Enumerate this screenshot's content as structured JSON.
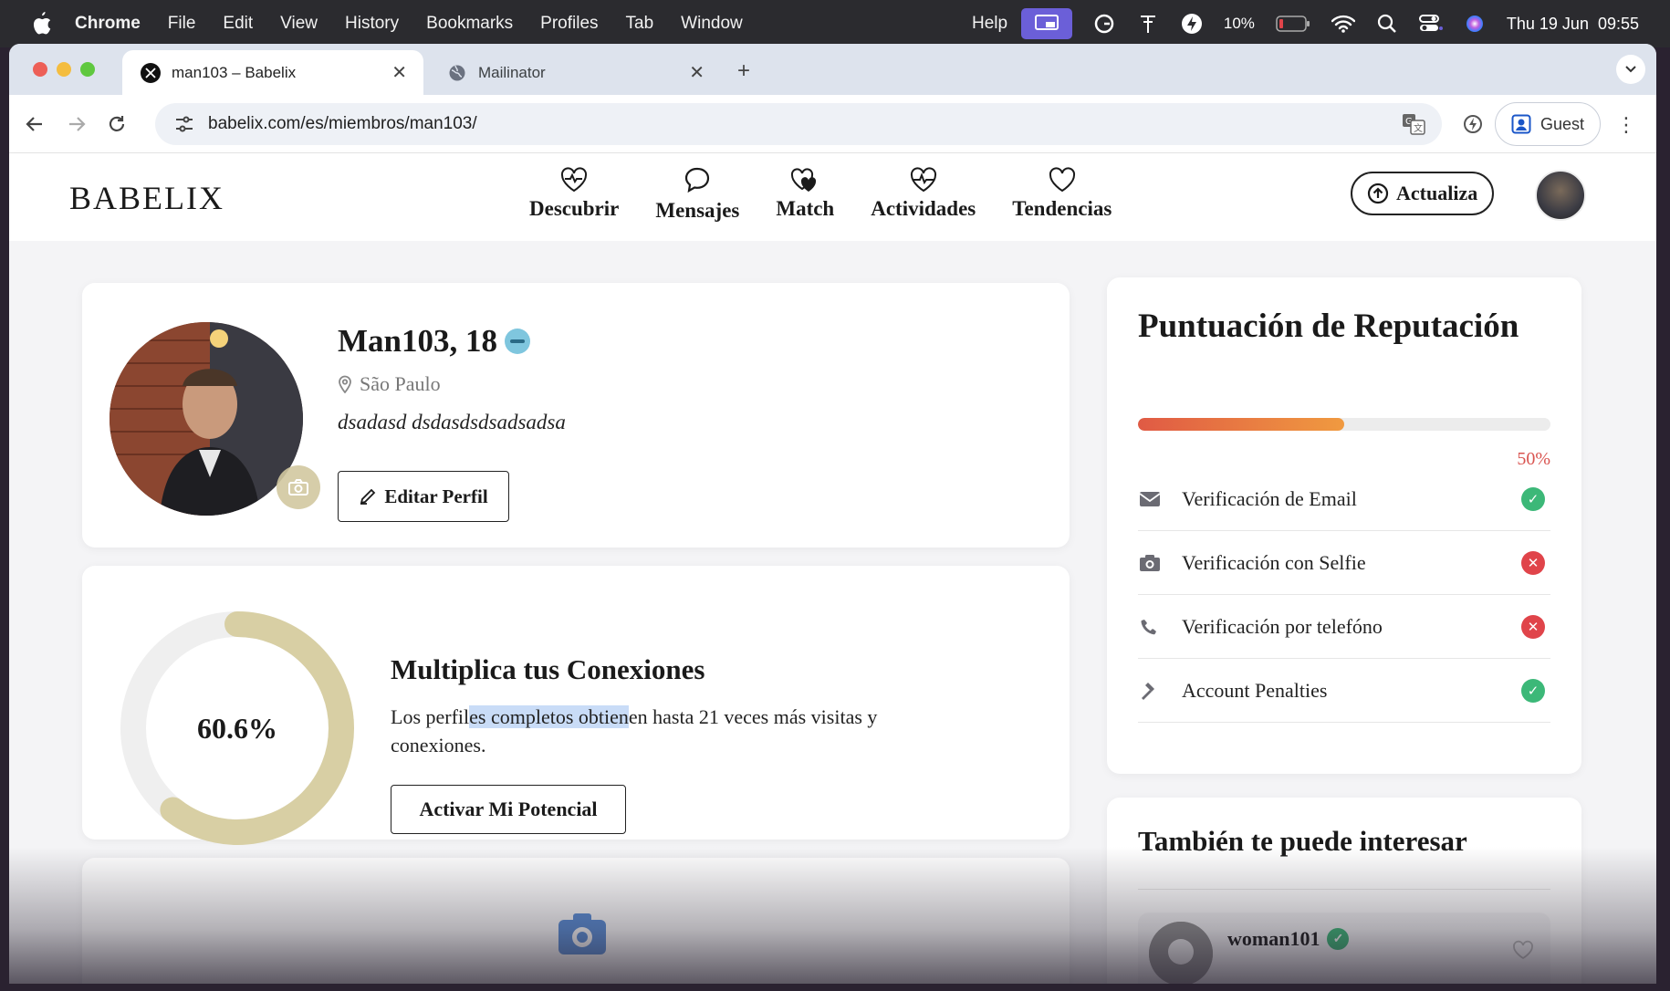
{
  "menubar": {
    "app": "Chrome",
    "items": [
      "File",
      "Edit",
      "View",
      "History",
      "Bookmarks",
      "Profiles",
      "Tab",
      "Window"
    ],
    "help": "Help",
    "battery": "10%",
    "datetime": "Thu 19 Jun  09:55"
  },
  "browser": {
    "tabs": [
      {
        "title": "man103 – Babelix",
        "active": true,
        "icon": "x-logo-icon"
      },
      {
        "title": "Mailinator",
        "active": false,
        "icon": "globe-icon"
      }
    ],
    "url": "babelix.com/es/miembros/man103/",
    "profile_label": "Guest"
  },
  "site": {
    "logo": "BABELIX",
    "nav": [
      {
        "label": "Descubrir",
        "icon": "heartbeat-heart-icon"
      },
      {
        "label": "Mensajes",
        "icon": "chat-bubble-icon"
      },
      {
        "label": "Match",
        "icon": "double-heart-icon"
      },
      {
        "label": "Actividades",
        "icon": "heartbeat-icon"
      },
      {
        "label": "Tendencias",
        "icon": "heart-outline-icon"
      }
    ],
    "upgrade_label": "Actualiza"
  },
  "profile": {
    "name": "Man103, 18",
    "location": "São Paulo",
    "bio": "dsadasd dsdasdsdsadsadsa",
    "edit_label": "Editar Perfil"
  },
  "connections": {
    "percent_label": "60.6%",
    "percent_value": 0.606,
    "title": "Multiplica tus Conexiones",
    "text_pre": "Los perfil",
    "text_highlight": "es completos obtien",
    "text_post": "en hasta 21 veces más visitas y conexiones.",
    "button": "Activar Mi Potencial"
  },
  "reputation": {
    "title": "Puntuación de Reputación",
    "percent_label": "50%",
    "percent_value": 0.5,
    "items": [
      {
        "label": "Verificación de Email",
        "icon": "envelope-icon",
        "status": "ok"
      },
      {
        "label": "Verificación con Selfie",
        "icon": "camera-icon",
        "status": "fail"
      },
      {
        "label": "Verificación por telefóno",
        "icon": "phone-icon",
        "status": "fail"
      },
      {
        "label": "Account Penalties",
        "icon": "gavel-icon",
        "status": "ok"
      }
    ]
  },
  "suggestions": {
    "title": "También te puede interesar",
    "items": [
      {
        "name": "woman101",
        "verified": true
      }
    ]
  },
  "colors": {
    "ok": "#3cb878",
    "fail": "#e0444a",
    "ring": "#d8cfa4",
    "ring_track": "#efefef",
    "accent": "#d9534f"
  }
}
